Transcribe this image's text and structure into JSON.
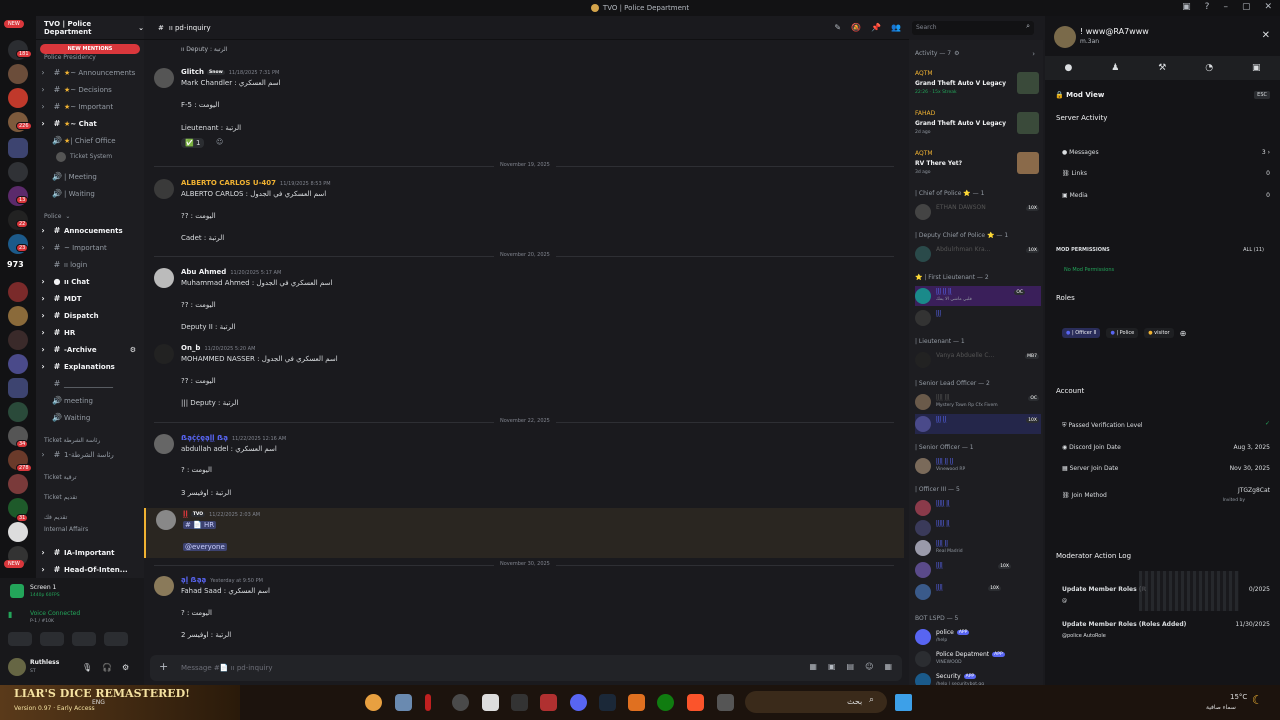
{
  "window": {
    "title": "TVO | Police Department"
  },
  "guilds": {
    "top_badge": "NEW",
    "bottom_badge": "NEW",
    "badges": [
      "181",
      "226",
      "13",
      "22",
      "23",
      "973",
      "34",
      "278",
      "31"
    ]
  },
  "sidebar": {
    "server_name": "TVO | Police Department",
    "new_mentions": "NEW MENTIONS",
    "top_category": "Police Presidency",
    "items_top": [
      {
        "label": "~ Announcements",
        "icon": "#"
      },
      {
        "label": "~ Decisions",
        "icon": "#"
      },
      {
        "label": "~ Important",
        "icon": "#"
      },
      {
        "label": "~ Chat",
        "icon": "#"
      },
      {
        "label": "| Chief Office",
        "icon": "🔊"
      }
    ],
    "ticket_user": "Ticket System",
    "items_mid": [
      {
        "label": "| Meeting",
        "icon": "🔊"
      },
      {
        "label": "| Waiting",
        "icon": "🔊"
      }
    ],
    "police_category": "Police",
    "police_items": [
      {
        "label": "Annocuements",
        "icon": "#"
      },
      {
        "label": "~ Important",
        "icon": "#"
      },
      {
        "label": "ıı login",
        "icon": "#"
      },
      {
        "label": "ıı Chat",
        "icon": "💬"
      },
      {
        "label": "MDT",
        "icon": "#"
      },
      {
        "label": "Dispatch",
        "icon": "#"
      },
      {
        "label": "HR",
        "icon": "#"
      },
      {
        "label": "-Archive",
        "icon": "#"
      },
      {
        "label": "Explanations",
        "icon": "#"
      },
      {
        "label": "______________",
        "icon": "#"
      },
      {
        "label": "meeting",
        "icon": "🔊"
      },
      {
        "label": "Waiting",
        "icon": "🔊"
      }
    ],
    "ticket_categories": [
      "Ticket رئاسة الشرطة",
      "رئاسة الشرطة-1",
      "Ticket ترقية",
      "Ticket تقديم"
    ],
    "more_categories": [
      "تقديم فك",
      "Internal Affairs"
    ],
    "bottom_items": [
      "IA-Important",
      "Head-Of-Inten..."
    ],
    "stream": {
      "title": "Screen 1",
      "sub": "1440p 60FPS"
    },
    "voice": {
      "status": "Voice Connected",
      "sub": "P-1 / #10K"
    },
    "user": {
      "name": "Ruthless",
      "sub": "ST"
    }
  },
  "chat": {
    "channel": "ıı pd-inquiry",
    "composer_placeholder": "Message #📄 ıı pd-inquiry",
    "messages": [
      {
        "reply": "ıı Deputy : الرتبة",
        "name": "Glitch",
        "tag": "Snow",
        "time": "11/18/2025 7:31 PM",
        "lines": [
          "Mark Chandler : اسم العسكري",
          "F-5 : اليومت",
          "Lieutenant : الرتبة"
        ],
        "reaction": "1"
      },
      {
        "date": "November 19, 2025"
      },
      {
        "name": "ALBERTO CARLOS U-407",
        "time": "11/19/2025 8:53 PM",
        "lines": [
          "ALBERTO CARLOS : اسم العسكري في الجدول",
          "?? : اليومت",
          "Cadet : الرتبة"
        ]
      },
      {
        "date": "November 20, 2025"
      },
      {
        "name": "Abu Ahmed",
        "time": "11/20/2025 5:17 AM",
        "lines": [
          "Muhammad Ahmed : اسم العسكري في الجدول",
          "?? : اليومت",
          "Deputy II : الرتبة"
        ]
      },
      {
        "name": "On_b",
        "time": "11/20/2025 5:20 AM",
        "lines": [
          "MOHAMMED NASSER : اسم العسكري في الجدول",
          "?? : اليومت",
          "||| Deputy : الرتبة"
        ]
      },
      {
        "date": "November 22, 2025"
      },
      {
        "name": "ẞḁḉḉḙḁḽḽ ẞḁ",
        "time": "11/22/2025 12:16 AM",
        "lines": [
          "abdullah adel : اسم العسكري",
          "? : اليومت",
          "الرتبة : اوفيسر 3"
        ]
      },
      {
        "name": "ḽḽ",
        "tag": "TVO",
        "time": "11/22/2025 2:03 AM",
        "lines": [
          "# 📄 HR",
          "@everyone"
        ]
      },
      {
        "date": "November 30, 2025"
      },
      {
        "name": "ḁḽ ẞḁḁ",
        "time": "Yesterday at 9:50 PM",
        "lines": [
          "Fahad Saad : اسم العسكري",
          "? : اليومت",
          "الرتبة : اوفيسر 2"
        ]
      }
    ]
  },
  "members": {
    "activity_header": "Activity — 7",
    "activities": [
      {
        "user": "AQTM",
        "game": "Grand Theft Auto V Legacy",
        "sub": "22:26 · 15x Streak"
      },
      {
        "user": "FAHAD",
        "game": "Grand Theft Auto V Legacy",
        "sub": "2d ago"
      },
      {
        "user": "AQTM",
        "game": "RV There Yet?",
        "sub": "3d ago"
      }
    ],
    "groups": [
      {
        "title": "| Chief of Police ⭐ — 1",
        "members": [
          {
            "name": "ETHAN DAWSON",
            "sub": "",
            "tag": "10X"
          }
        ]
      },
      {
        "title": "| Deputy Chief of Police ⭐ — 1",
        "members": [
          {
            "name": "Abdulrhman Kra...",
            "sub": "",
            "tag": "10X"
          }
        ]
      },
      {
        "title": "⭐ | First Lieutenant — 2",
        "members": [
          {
            "name": "ḽḽḽ ḽḽ ḽḽ",
            "sub": "قلبي ماشي الا يمك",
            "tag": "OC"
          },
          {
            "name": "ḽḽḽ",
            "sub": "",
            "tag": ""
          }
        ]
      },
      {
        "title": "| Lieutenant — 1",
        "members": [
          {
            "name": "Vanya Abduelle C...",
            "sub": "",
            "tag": "MB7"
          }
        ]
      },
      {
        "title": "| Senior Lead Officer — 2",
        "members": [
          {
            "name": "ḽḽḽḽ ḽḽḽ",
            "sub": "Mystery Town Rp Cfx Fivem",
            "tag": "OC"
          },
          {
            "name": "ḽḽḽ ḽḽ",
            "sub": "",
            "tag": "10X"
          }
        ]
      },
      {
        "title": "| Senior Officer — 1",
        "members": [
          {
            "name": "ḽḽḽḽ ḽḽ ḽḽ",
            "sub": "Vinewood RP",
            "tag": ""
          }
        ]
      },
      {
        "title": "| Officer III — 5",
        "members": [
          {
            "name": "ḽḽḽḽḽ ḽḽ",
            "sub": "",
            "tag": ""
          },
          {
            "name": "ḽḽḽḽḽ ḽḽ",
            "sub": "",
            "tag": ""
          },
          {
            "name": "ḽḽḽḽ ḽḽ",
            "sub": "Real Madrid",
            "tag": ""
          },
          {
            "name": "ḽḽḽḽ",
            "sub": "",
            "tag": "10X"
          },
          {
            "name": "ḽḽḽḽ",
            "sub": "",
            "tag": "10X"
          }
        ]
      },
      {
        "title": "BOT LSPD — 5",
        "members": [
          {
            "name": "police",
            "sub": "/help",
            "tag": "APP"
          },
          {
            "name": "Police Depatment",
            "sub": "VINEWOOD",
            "tag": "APP"
          },
          {
            "name": "Security",
            "sub": "/help | securitybot.gg",
            "tag": "APP"
          }
        ]
      }
    ]
  },
  "search": {
    "placeholder": "Search"
  },
  "profile": {
    "name": "! www@RA7www",
    "sub": "m.3an",
    "mod_view": "Mod View",
    "esc": "ESC",
    "server_activity": "Server Activity",
    "messages_label": "Messages",
    "messages_count": "3",
    "links_label": "Links",
    "links_count": "0",
    "media_label": "Media",
    "media_count": "0",
    "mod_perm_title": "MOD PERMISSIONS",
    "mod_perm_all": "ALL (11)",
    "no_mod_perm": "No Mod Permissions",
    "roles_title": "Roles",
    "roles": [
      "| Officer II",
      "| Police",
      "visitor"
    ],
    "account_title": "Account",
    "verification": "Passed Verification Level",
    "discord_join_label": "Discord Join Date",
    "discord_join": "Aug 3, 2025",
    "server_join_label": "Server Join Date",
    "server_join": "Nov 30, 2025",
    "join_method_label": "Join Method",
    "join_method": "JTGZg8Cat",
    "invited_by": "Invited by",
    "log_title": "Moderator Action Log",
    "log": [
      {
        "action": "Update Member Roles (R",
        "who": "@",
        "date": "0/2025"
      },
      {
        "action": "Update Member Roles (Roles Added)",
        "who": "@police AutoRole",
        "date": "11/30/2025"
      }
    ]
  },
  "taskbar": {
    "game_title": "LIAR'S DICE REMASTERED!",
    "game_sub": "Version 0.97 · Early Access",
    "temp": "15°C",
    "weather": "سماء صافية",
    "search": "بحث",
    "lang": "ENG"
  },
  "colors": {
    "accent": "#5865f2",
    "danger": "#da373c",
    "online": "#23a55a",
    "gold": "#f0b232"
  }
}
